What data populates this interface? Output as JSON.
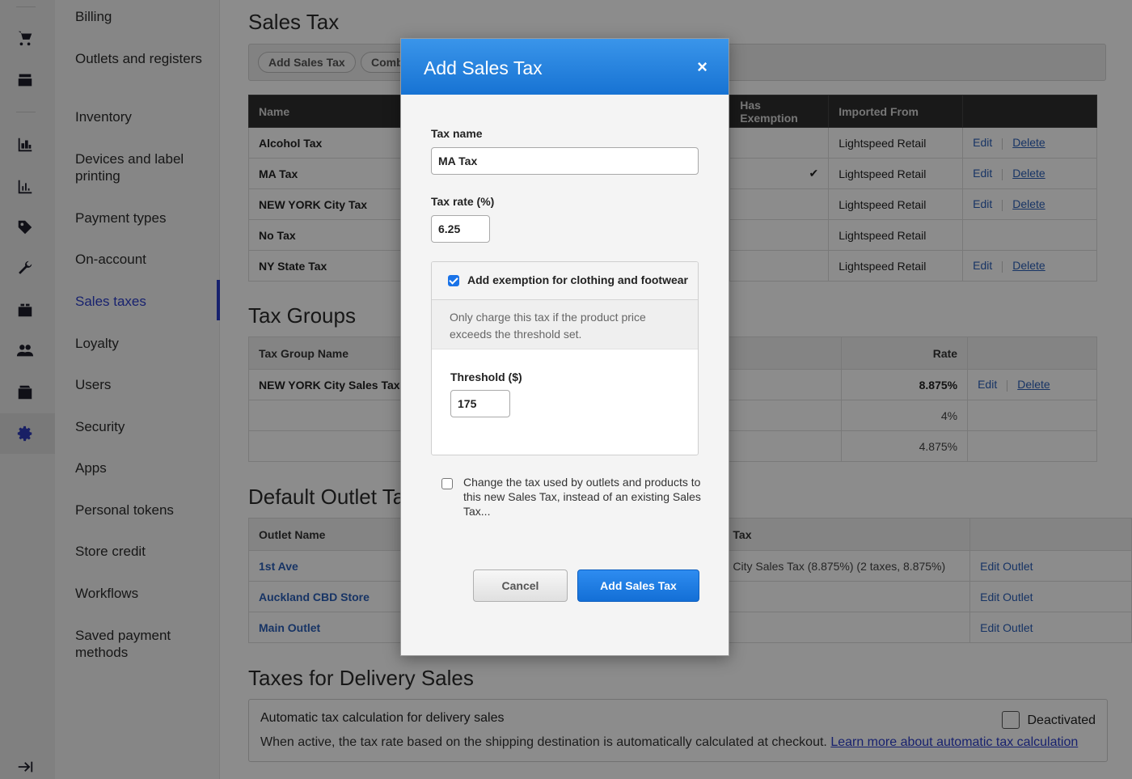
{
  "subnav": {
    "items": [
      "Billing",
      "Outlets and registers",
      "Inventory",
      "Devices and label printing",
      "Payment types",
      "On-account",
      "Sales taxes",
      "Loyalty",
      "Users",
      "Security",
      "Apps",
      "Personal tokens",
      "Store credit",
      "Workflows",
      "Saved payment methods"
    ],
    "active": "Sales taxes"
  },
  "sales_tax": {
    "title": "Sales Tax",
    "toolbar": [
      "Add Sales Tax",
      "Comb"
    ],
    "columns": [
      "Name",
      "Has Exemption",
      "Imported From"
    ],
    "rows": [
      {
        "name": "Alcohol Tax",
        "exempt": "",
        "from": "Lightspeed Retail",
        "edit": "Edit",
        "delete": "Delete"
      },
      {
        "name": "MA Tax",
        "exempt": "✔",
        "from": "Lightspeed Retail",
        "edit": "Edit",
        "delete": "Delete"
      },
      {
        "name": "NEW YORK City Tax",
        "exempt": "",
        "from": "Lightspeed Retail",
        "edit": "Edit",
        "delete": "Delete"
      },
      {
        "name": "No Tax",
        "exempt": "",
        "from": "Lightspeed Retail",
        "edit": "",
        "delete": ""
      },
      {
        "name": "NY State Tax",
        "exempt": "",
        "from": "Lightspeed Retail",
        "edit": "Edit",
        "delete": "Delete"
      }
    ]
  },
  "tax_groups": {
    "title": "Tax Groups",
    "columns": [
      "Tax Group Name",
      "Rate"
    ],
    "rows": [
      {
        "name": "NEW YORK City Sales Tax",
        "rate": "8.875%",
        "edit": "Edit",
        "delete": "Delete"
      },
      {
        "name": "",
        "rate": "4%",
        "edit": "",
        "delete": ""
      },
      {
        "name": "",
        "rate": "4.875%",
        "edit": "",
        "delete": ""
      }
    ]
  },
  "default_outlet": {
    "title": "Default Outlet Tax",
    "columns": [
      "Outlet Name",
      "Tax"
    ],
    "rows": [
      {
        "name": "1st Ave",
        "tax": "City Sales Tax (8.875%) (2 taxes, 8.875%)",
        "action": "Edit Outlet"
      },
      {
        "name": "Auckland CBD Store",
        "tax": "",
        "action": "Edit Outlet"
      },
      {
        "name": "Main Outlet",
        "tax": "",
        "action": "Edit Outlet"
      }
    ]
  },
  "delivery": {
    "title": "Taxes for Delivery Sales",
    "box_title": "Automatic tax calculation for delivery sales",
    "description": "When active, the tax rate based on the shipping destination is automatically calculated at checkout.",
    "link": "Learn more about automatic tax calculation",
    "toggle_label": "Deactivated"
  },
  "modal": {
    "title": "Add Sales Tax",
    "close": "×",
    "tax_name_label": "Tax name",
    "tax_name_value": "MA Tax",
    "tax_rate_label": "Tax rate (%)",
    "tax_rate_value": "6.25",
    "exemption_label": "Add exemption for clothing and footwear",
    "exemption_checked": true,
    "exemption_desc": "Only charge this tax if the product price exceeds the threshold set.",
    "threshold_label": "Threshold ($)",
    "threshold_value": "175",
    "change_label": "Change the tax used by outlets and products to this new Sales Tax, instead of an existing Sales Tax...",
    "change_checked": false,
    "cancel": "Cancel",
    "submit": "Add Sales Tax"
  },
  "icons": [
    "cart-icon",
    "register-icon",
    "inventory-icon",
    "reports-icon",
    "tag-icon",
    "tools-icon",
    "catalog-icon",
    "customers-icon",
    "wallet-icon",
    "settings-icon",
    "collapse-icon"
  ]
}
